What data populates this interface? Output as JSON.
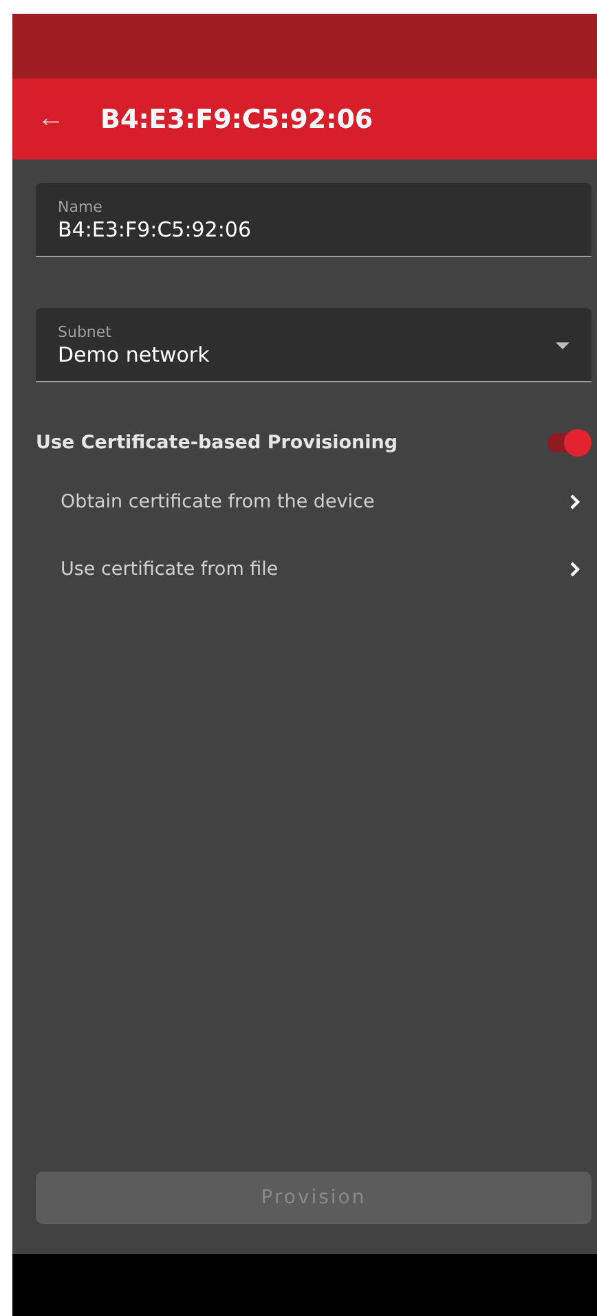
{
  "app_bar": {
    "back_icon": "←",
    "title": "B4:E3:F9:C5:92:06"
  },
  "fields": [
    {
      "kind": "text",
      "label": "Name",
      "value": "B4:E3:F9:C5:92:06"
    },
    {
      "kind": "select",
      "label": "Subnet",
      "value": "Demo network"
    }
  ],
  "certificate_toggle": {
    "label": "Use Certificate-based Provisioning",
    "on": true
  },
  "options": [
    {
      "label": "Obtain certificate from the device"
    },
    {
      "label": "Use certificate from file"
    }
  ],
  "provision_button": {
    "label": "Provision",
    "disabled": true
  }
}
